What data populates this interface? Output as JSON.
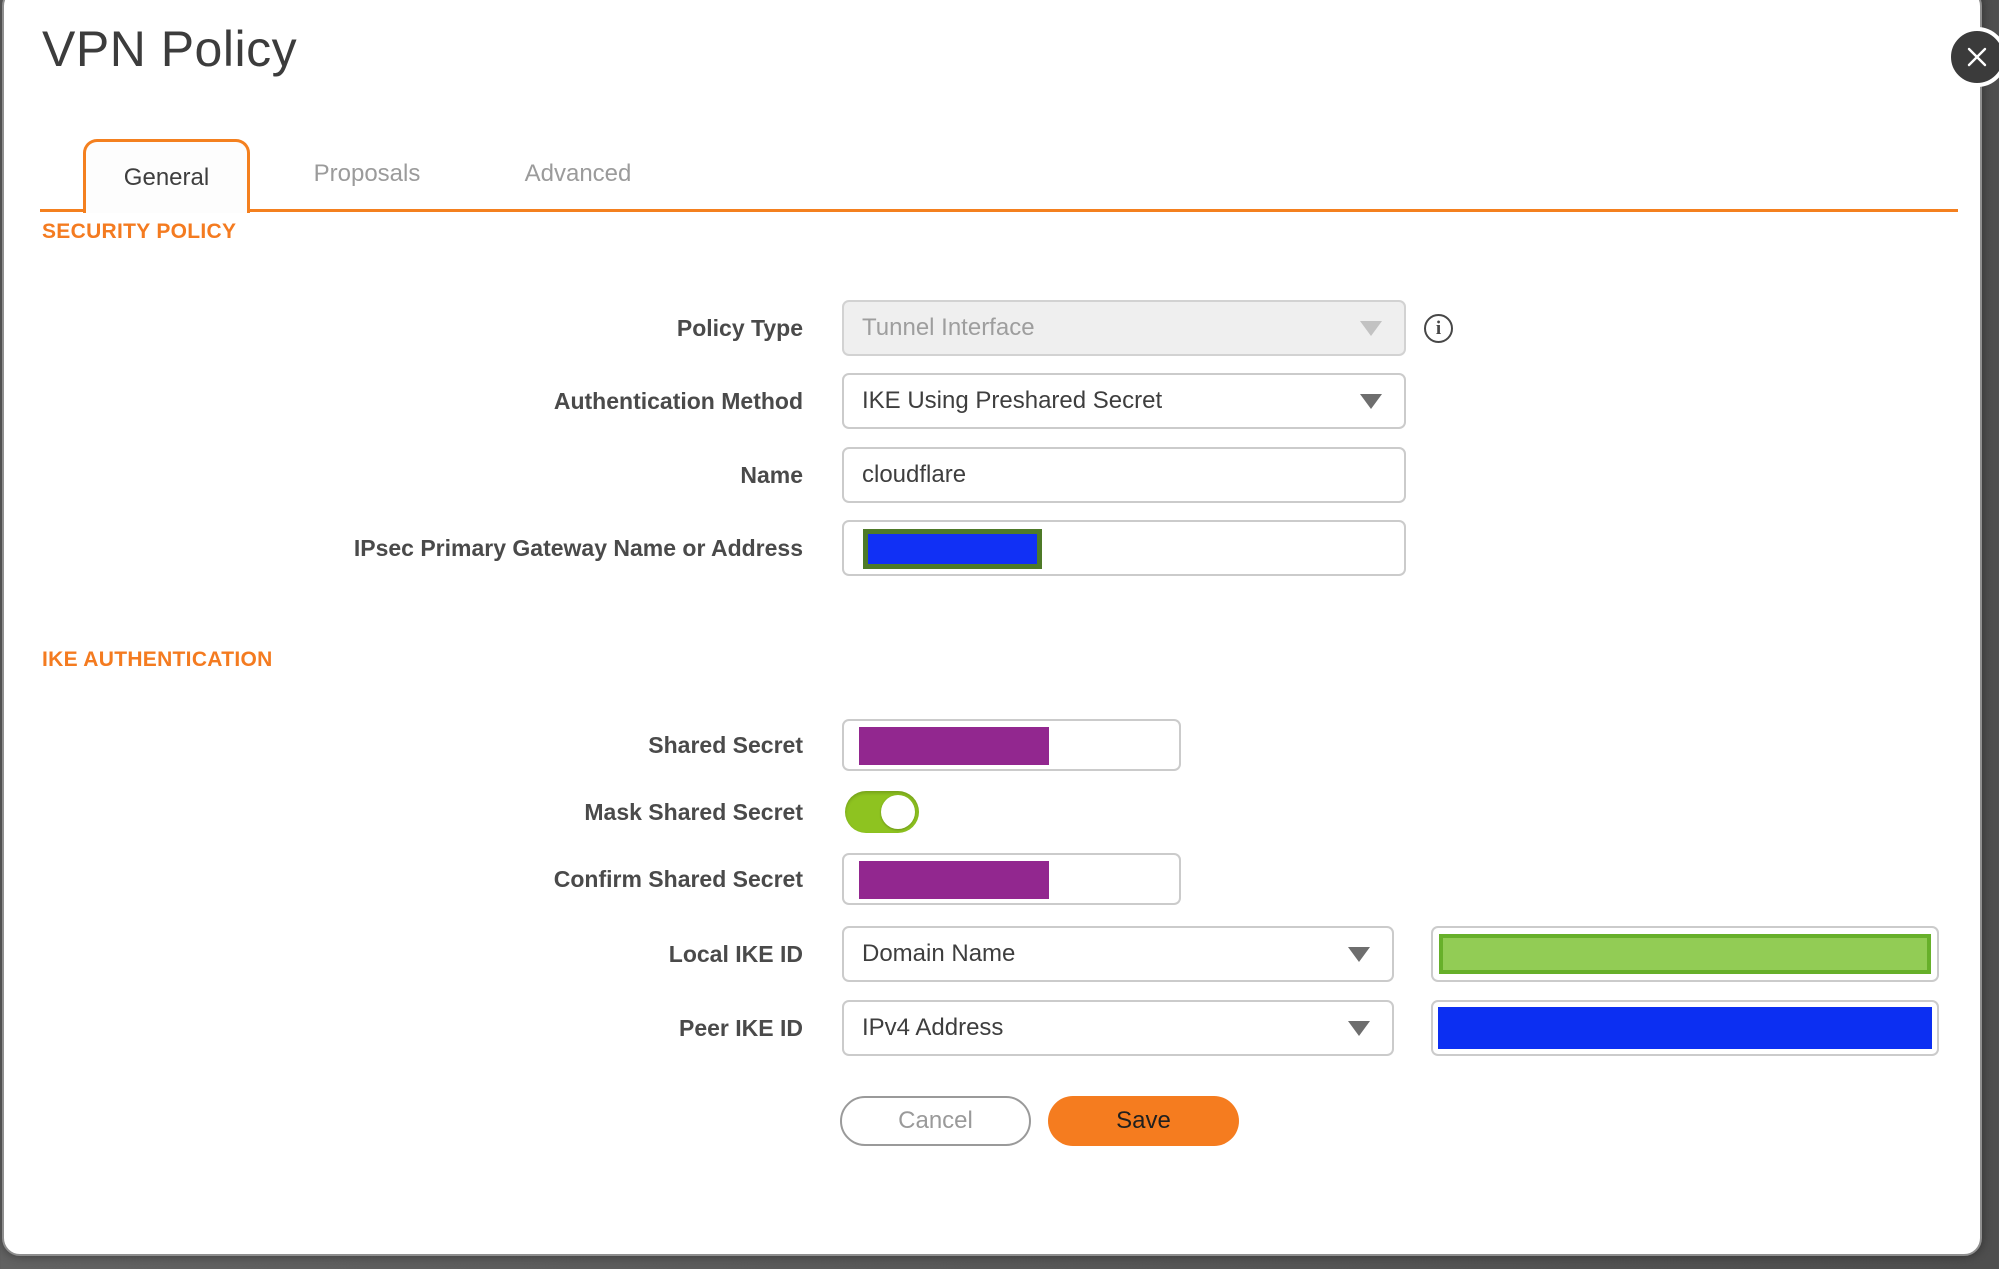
{
  "dialog": {
    "title": "VPN Policy"
  },
  "tabs": {
    "items": [
      {
        "label": "General",
        "active": true
      },
      {
        "label": "Proposals",
        "active": false
      },
      {
        "label": "Advanced",
        "active": false
      }
    ]
  },
  "security_policy": {
    "heading": "SECURITY POLICY",
    "policy_type": {
      "label": "Policy Type",
      "value": "Tunnel Interface",
      "disabled": true,
      "info_icon": "i"
    },
    "authentication_method": {
      "label": "Authentication Method",
      "value": "IKE Using Preshared Secret"
    },
    "name": {
      "label": "Name",
      "value": "cloudflare"
    },
    "gateway": {
      "label": "IPsec Primary Gateway Name or Address",
      "value_redacted": true
    }
  },
  "ike_authentication": {
    "heading": "IKE AUTHENTICATION",
    "shared_secret": {
      "label": "Shared Secret",
      "value_redacted": true
    },
    "mask_shared_secret": {
      "label": "Mask Shared Secret",
      "enabled": true
    },
    "confirm_shared_secret": {
      "label": "Confirm Shared Secret",
      "value_redacted": true
    },
    "local_ike_id": {
      "label": "Local IKE ID",
      "type": "Domain Name",
      "value_redacted": true
    },
    "peer_ike_id": {
      "label": "Peer IKE ID",
      "type": "IPv4 Address",
      "value_redacted": true
    }
  },
  "actions": {
    "cancel_label": "Cancel",
    "save_label": "Save"
  },
  "colors": {
    "accent_orange": "#F47B20",
    "save_button_orange": "#F57C1F",
    "toggle_green": "#8EC320",
    "redact_purple": "#92278F",
    "redact_blue": "#0C2FF2",
    "redact_green_fill": "#92CC55",
    "redact_green_border": "#67B02A",
    "gateway_redact_blue": "#1130F5",
    "gateway_redact_border_olive": "#4E7A28"
  }
}
